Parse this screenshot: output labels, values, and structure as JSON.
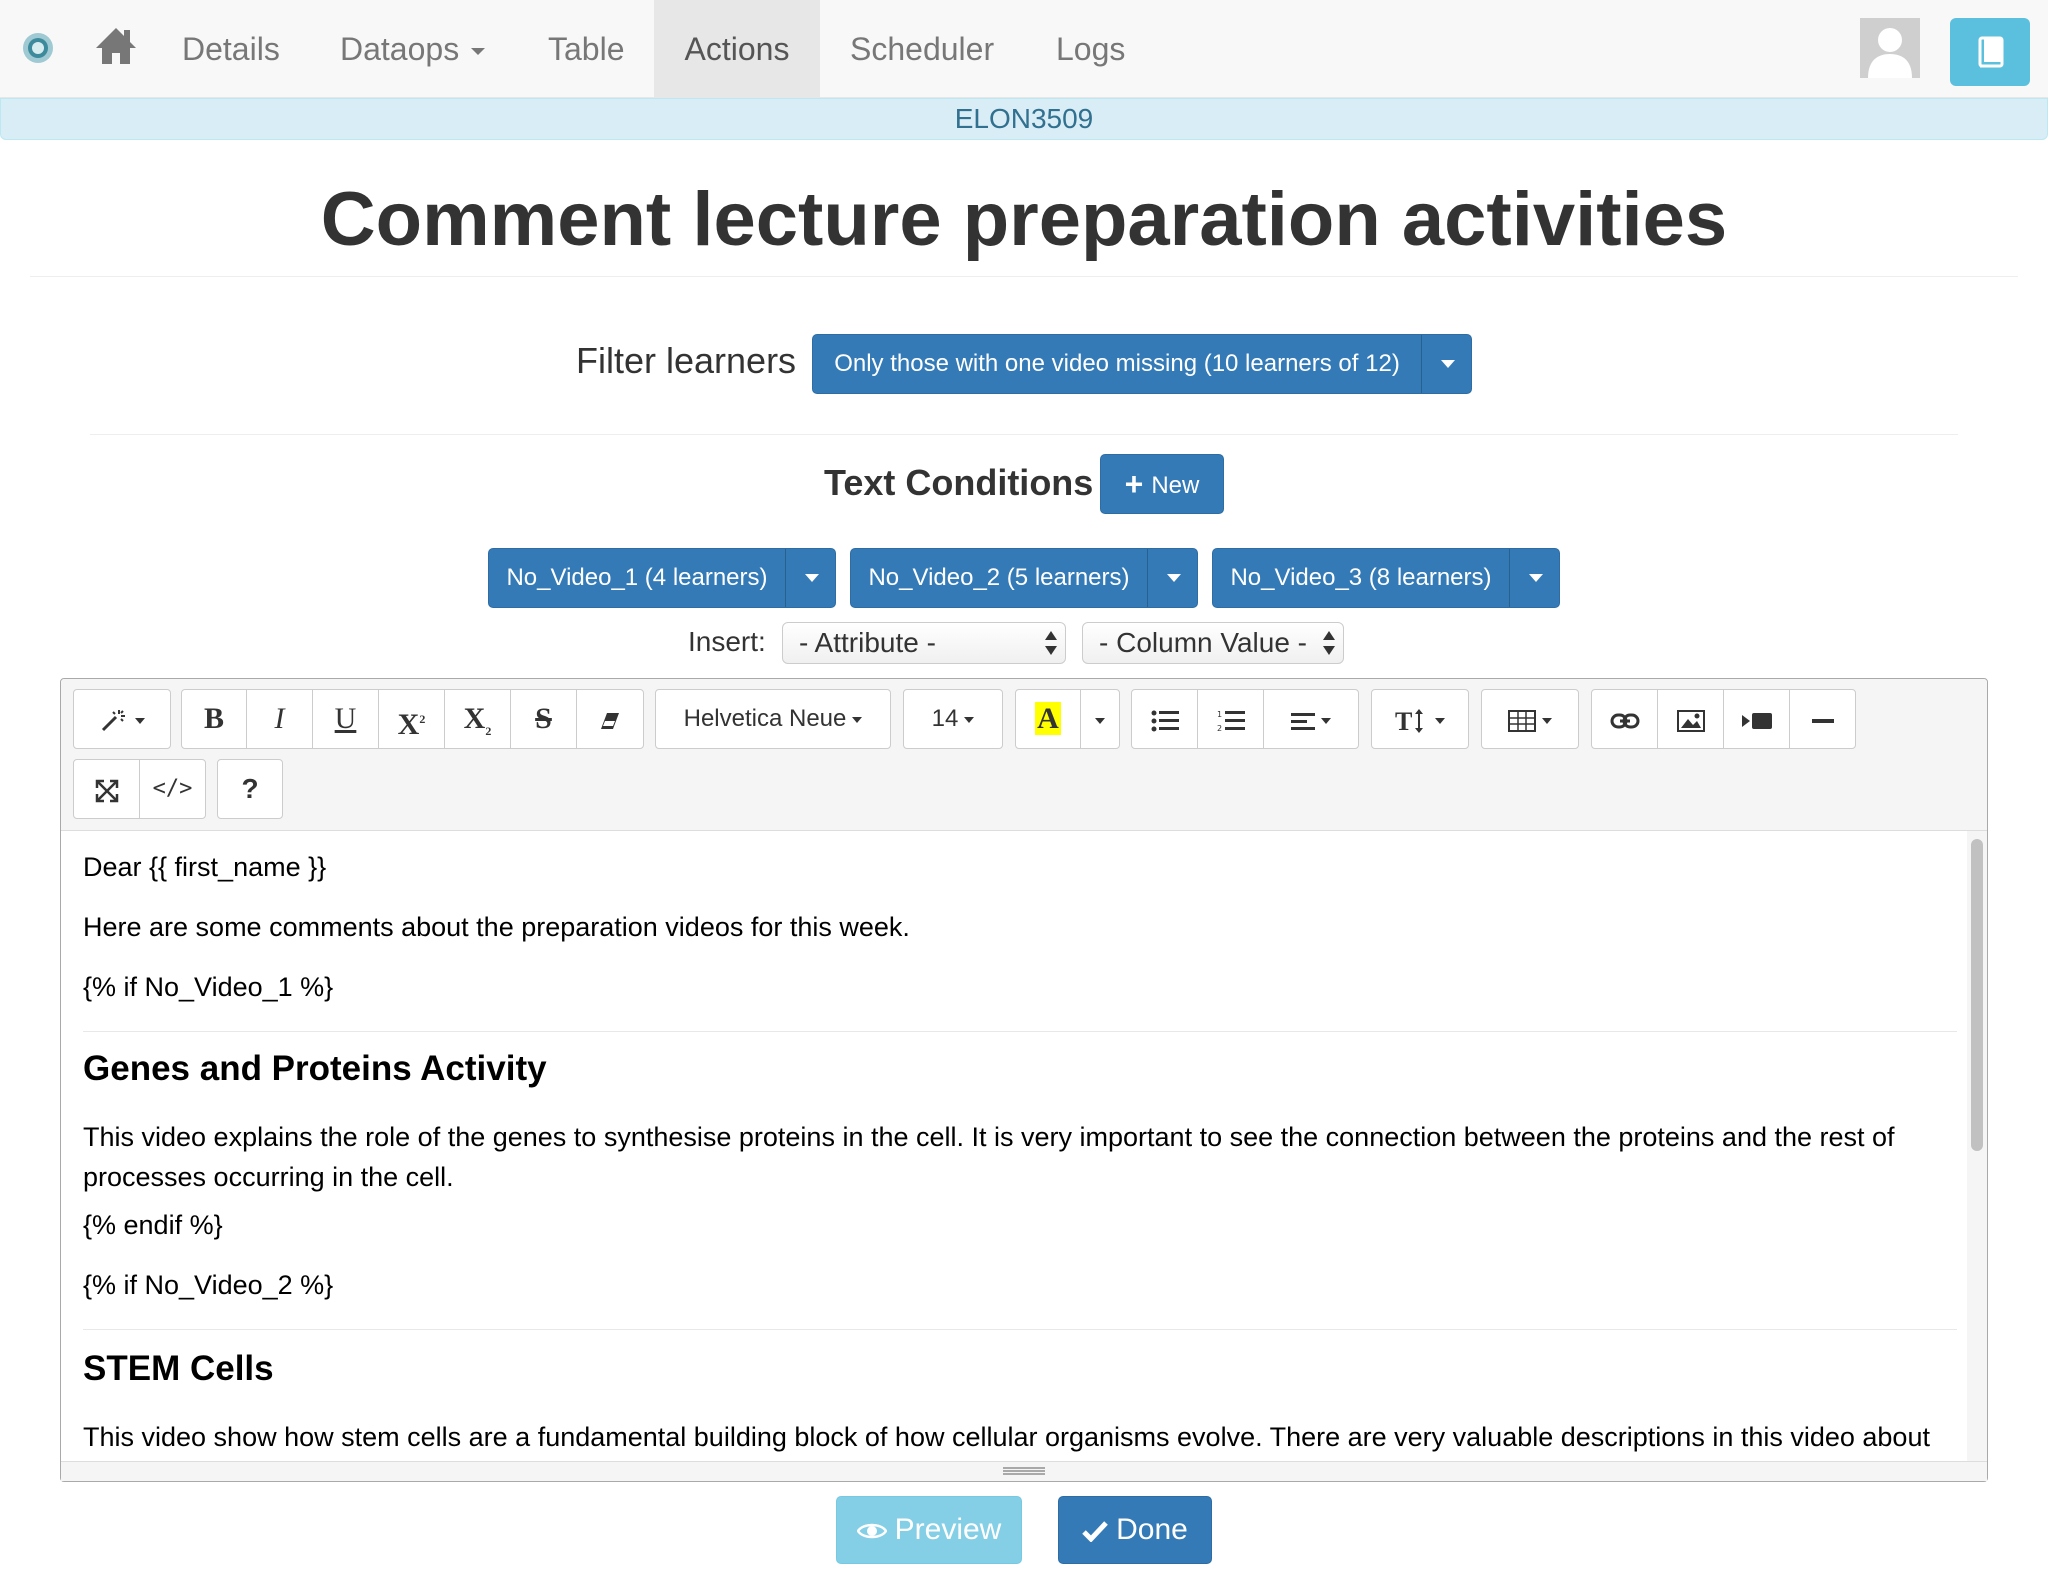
{
  "navbar": {
    "logo_icon": "ontask-logo-icon",
    "home_icon": "home-icon",
    "items": [
      {
        "label": "Details"
      },
      {
        "label": "Dataops"
      },
      {
        "label": "Table"
      },
      {
        "label": "Actions",
        "active": true
      },
      {
        "label": "Scheduler"
      },
      {
        "label": "Logs"
      }
    ],
    "avatar_icon": "user-avatar-icon",
    "book_icon": "book-icon"
  },
  "course_bar": {
    "text": "ELON3509"
  },
  "page": {
    "title": "Comment lecture preparation activities"
  },
  "filter": {
    "label": "Filter learners",
    "button": "Only those with one video missing (10 learners of 12)"
  },
  "text_conditions": {
    "label": "Text Conditions",
    "new_button": "New",
    "conditions": [
      {
        "label": "No_Video_1 (4 learners)"
      },
      {
        "label": "No_Video_2 (5 learners)"
      },
      {
        "label": "No_Video_3 (8 learners)"
      }
    ]
  },
  "insert": {
    "label": "Insert:",
    "attribute_select": "- Attribute -",
    "column_value_select": "- Column Value -"
  },
  "toolbar": {
    "magic": "magic-wand-icon",
    "bold": "B",
    "italic": "I",
    "underline": "U",
    "superscript": "X",
    "subscript": "X",
    "strikethrough": "S",
    "eraser": "eraser-icon",
    "font_name": "Helvetica Neue",
    "font_size": "14",
    "color_letter": "A",
    "help": "?",
    "code": "</>"
  },
  "editor": {
    "lines": [
      "Dear {{ first_name }}",
      "Here are some comments about the preparation videos for this week.",
      "{% if No_Video_1 %}",
      "This video explains the role of the genes to synthesise proteins in the cell. It is very important to see the connection between the proteins and the rest of processes occurring in the cell.",
      "{% endif %}",
      "{% if No_Video_2 %}",
      "This video show how stem cells are a fundamental building block of how cellular organisms evolve. There are very valuable descriptions in this video about the mechanisms that are involved in this specialization."
    ],
    "headings": [
      "Genes and Proteins Activity",
      "STEM Cells"
    ]
  },
  "footer": {
    "preview": "Preview",
    "done": "Done"
  },
  "colors": {
    "primary": "#337ab7",
    "info": "#5bc0de",
    "course_bar_bg": "#d9edf7",
    "course_bar_text": "#31708f",
    "highlight_yellow": "#ffff00"
  }
}
